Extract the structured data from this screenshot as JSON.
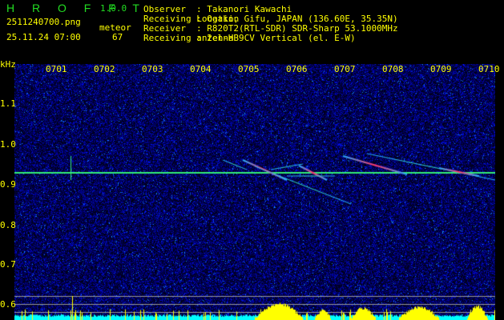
{
  "app": {
    "name": "H R O F F T",
    "version": "1.0.0"
  },
  "file": "2511240700.png",
  "datetime": "25.11.24 07:00",
  "meteor": {
    "label": "meteor",
    "count": "67"
  },
  "info": [
    {
      "label": "Observer",
      "value": ": Takanori Kawachi"
    },
    {
      "label": "Receiving Location",
      "value": ": Ogaki, Gifu, JAPAN (136.60E, 35.35N)"
    },
    {
      "label": "Receiver",
      "value": ": R820T2(RTL-SDR) SDR-Sharp 53.1000MHz"
    },
    {
      "label": "Receiving antenna",
      "value": ": 2el-HB9CV Vertical (el. E-W)"
    }
  ],
  "axis": {
    "y_unit": "kHz",
    "y_ticks": [
      "1.1",
      "1.0",
      "0.9",
      "0.8",
      "0.7",
      "0.6"
    ],
    "x_ticks": [
      "0701",
      "0702",
      "0703",
      "0704",
      "0705",
      "0706",
      "0707",
      "0708",
      "0709",
      "0710"
    ]
  },
  "colors": {
    "text": "#ffff00",
    "title": "#22dd22",
    "carrier": "#33ff66",
    "noise": "#1020a0"
  }
}
